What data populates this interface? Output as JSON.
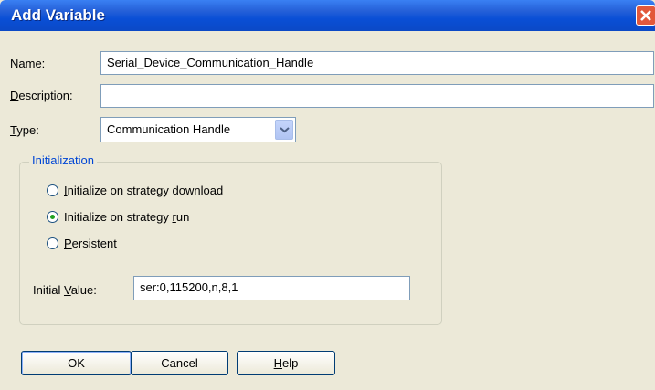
{
  "window": {
    "title": "Add Variable",
    "close_icon": "close-icon"
  },
  "name": {
    "label_prefix": "",
    "label_mnemonic": "N",
    "label_rest": "ame:",
    "value": "Serial_Device_Communication_Handle"
  },
  "description": {
    "label_mnemonic": "D",
    "label_rest": "escription:",
    "value": ""
  },
  "type": {
    "label_mnemonic": "T",
    "label_rest": "ype:",
    "selected": "Communication Handle"
  },
  "initialization": {
    "legend": "Initialization",
    "options": [
      {
        "pre": "",
        "mn": "I",
        "post": "nitialize on strategy download",
        "checked": false
      },
      {
        "pre": "Initialize on strategy ",
        "mn": "r",
        "post": "un",
        "checked": true
      },
      {
        "pre": "",
        "mn": "P",
        "post": "ersistent",
        "checked": false
      }
    ],
    "initial_value_label_pre": "Initial ",
    "initial_value_label_mn": "V",
    "initial_value_label_post": "alue:",
    "initial_value": "ser:0,115200,n,8,1"
  },
  "buttons": {
    "ok": "OK",
    "cancel": "Cancel",
    "help_mn": "H",
    "help_rest": "elp"
  },
  "colors": {
    "title_bar": "#0a4fd6",
    "dialog_bg": "#ece9d8",
    "legend_text": "#0046d5",
    "close_button": "#e2583b"
  }
}
